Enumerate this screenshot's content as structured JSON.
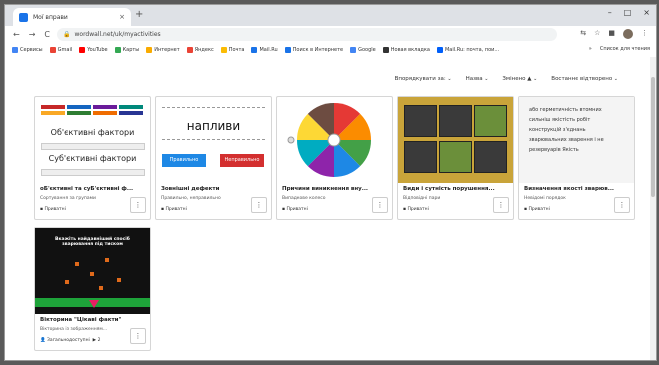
{
  "browser": {
    "tab_title": "Мої вправи",
    "tab_close": "×",
    "new_tab": "+",
    "window_controls": [
      "–",
      "□",
      "×"
    ],
    "nav": [
      "←",
      "→",
      "C"
    ],
    "url": "wordwall.net/uk/myactivities",
    "bookmarks": [
      "Сервисы",
      "Gmail",
      "YouTube",
      "Карты",
      "Интернет",
      "Яндекс",
      "Почта",
      "Mail.Ru",
      "Поиск в Интернете",
      "Google",
      "Новая вкладка",
      "Mail.Ru: почта, пои..."
    ],
    "bookmark_colors": [
      "#4285f4",
      "#ea4335",
      "#ff0000",
      "#34a853",
      "#f9ab00",
      "#ea4335",
      "#fbbc04",
      "#1a73e8",
      "#1a73e8",
      "#4285f4",
      "#333333",
      "#005ff9"
    ],
    "bookmarks_right": "Список для чтения"
  },
  "filters": [
    "Впорядкувати за:",
    "Назва",
    "Змінено ▲",
    "Востаннє відтворено"
  ],
  "cards": [
    {
      "title": "оБ'єктивні та суБ'єктивні ф...",
      "type": "Сортування за групами",
      "visibility": "Приватні",
      "menu": "⋮",
      "thumb": {
        "label1": "Об'єктивні фактори",
        "label2": "Суб'єктивні фактори"
      }
    },
    {
      "title": "Зовнішні дефекти",
      "type": "Правильно, неправильно",
      "visibility": "Приватні",
      "menu": "⋮",
      "thumb": {
        "word": "напливи",
        "btn_true": "Правильно",
        "btn_false": "Неправильно"
      }
    },
    {
      "title": "Причини виникнення вну...",
      "type": "Випадкове колесо",
      "visibility": "Приватні",
      "menu": "⋮",
      "thumb": {
        "wheel_colors": [
          "#e53935",
          "#fb8c00",
          "#43a047",
          "#1e88e5",
          "#8e24aa",
          "#00acc1",
          "#fdd835",
          "#6d4c41"
        ]
      }
    },
    {
      "title": "Види і сутність порушення...",
      "type": "Відповідні пари",
      "visibility": "Приватні",
      "menu": "⋮",
      "thumb": {}
    },
    {
      "title": "Визначення якості зварюв...",
      "type": "Невідомі порядок",
      "visibility": "Приватні",
      "menu": "⋮",
      "thumb": {
        "text": "або герметичність втомних сильніш якістість робіт конструкцій з'єднань зварювальних зварення і не резервуарів Якість"
      }
    },
    {
      "title": "Вікторина \"Цікаві факти\"",
      "type": "Вікторина із зображенням...",
      "visibility": "Загальнодоступні",
      "plays": "2",
      "menu": "⋮",
      "thumb": {
        "head": "Вкажіть найдавніший спосіб зварювання під тиском"
      }
    }
  ]
}
